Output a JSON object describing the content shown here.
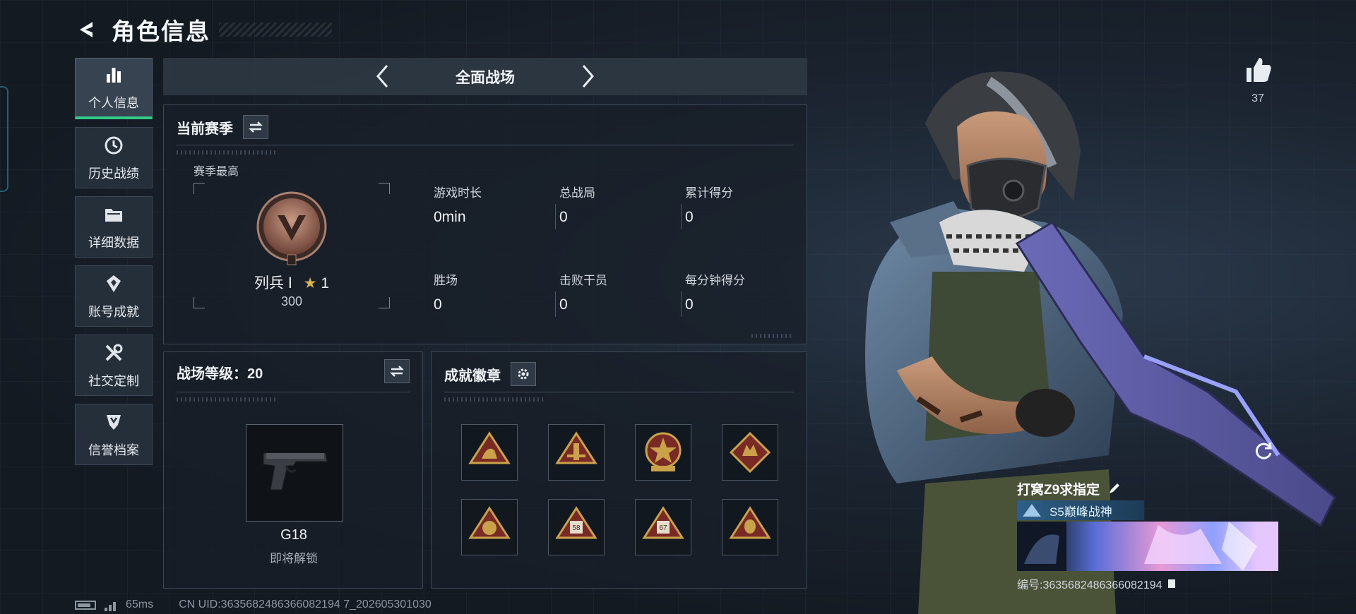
{
  "header": {
    "title": "角色信息"
  },
  "sidebar": {
    "items": [
      {
        "label": "个人信息",
        "icon": "bar-chart-icon",
        "active": true
      },
      {
        "label": "历史战绩",
        "icon": "history-clock-icon"
      },
      {
        "label": "详细数据",
        "icon": "folder-icon"
      },
      {
        "label": "账号成就",
        "icon": "achievement-icon"
      },
      {
        "label": "社交定制",
        "icon": "tools-icon"
      },
      {
        "label": "信誉档案",
        "icon": "credit-shield-icon"
      }
    ]
  },
  "mode": {
    "title": "全面战场"
  },
  "season": {
    "title": "当前赛季",
    "best_label": "赛季最高",
    "rank_name": "列兵 Ⅰ",
    "rank_stars": "1",
    "rank_score": "300",
    "stats": [
      {
        "label": "游戏时长",
        "value": "0min"
      },
      {
        "label": "总战局",
        "value": "0"
      },
      {
        "label": "累计得分",
        "value": "0"
      },
      {
        "label": "胜场",
        "value": "0"
      },
      {
        "label": "击败干员",
        "value": "0"
      },
      {
        "label": "每分钟得分",
        "value": "0"
      }
    ]
  },
  "battlefield_level": {
    "title": "战场等级：20",
    "weapon_name": "G18",
    "weapon_status": "即将解锁"
  },
  "achievements": {
    "title": "成就徽章",
    "badge_labels": [
      "58",
      "67"
    ]
  },
  "like": {
    "count": "37"
  },
  "card": {
    "name": "打窝Z9求指定",
    "title": "S5巅峰战神",
    "uid": "编号:3635682486366082194"
  },
  "status": {
    "ping": "65ms",
    "uid": "CN UID:3635682486366082194 7_202605301030"
  },
  "colors": {
    "accent_green": "#35c98a",
    "gold": "#c9a24a",
    "badge_red": "#7a2a24"
  }
}
